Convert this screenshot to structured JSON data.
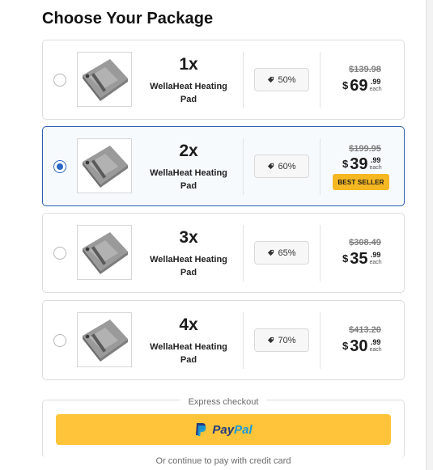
{
  "title": "Choose Your Package",
  "colors": {
    "accent": "#2b67c6",
    "badge": "#f5b722",
    "paypal": "#ffc439"
  },
  "packages": [
    {
      "qty": "1x",
      "name": "WellaHeat Heating Pad",
      "discount": "50%",
      "old_price": "$139.98",
      "currency": "$",
      "whole": "69",
      "cents": ".99",
      "each": "each",
      "badge": "",
      "selected": false
    },
    {
      "qty": "2x",
      "name": "WellaHeat Heating Pad",
      "discount": "60%",
      "old_price": "$199.95",
      "currency": "$",
      "whole": "39",
      "cents": ".99",
      "each": "each",
      "badge": "BEST SELLER",
      "selected": true
    },
    {
      "qty": "3x",
      "name": "WellaHeat Heating Pad",
      "discount": "65%",
      "old_price": "$308.49",
      "currency": "$",
      "whole": "35",
      "cents": ".99",
      "each": "each",
      "badge": "",
      "selected": false
    },
    {
      "qty": "4x",
      "name": "WellaHeat Heating Pad",
      "discount": "70%",
      "old_price": "$413.20",
      "currency": "$",
      "whole": "30",
      "cents": ".99",
      "each": "each",
      "badge": "",
      "selected": false
    }
  ],
  "express": {
    "title": "Express checkout",
    "paypal_a": "Pay",
    "paypal_b": "Pal",
    "or_text": "Or continue to pay with credit card"
  },
  "icons": {
    "radio": "radio-icon",
    "tag": "tag-icon",
    "paypal": "paypal-logo-icon",
    "product": "heating-pad-image"
  }
}
